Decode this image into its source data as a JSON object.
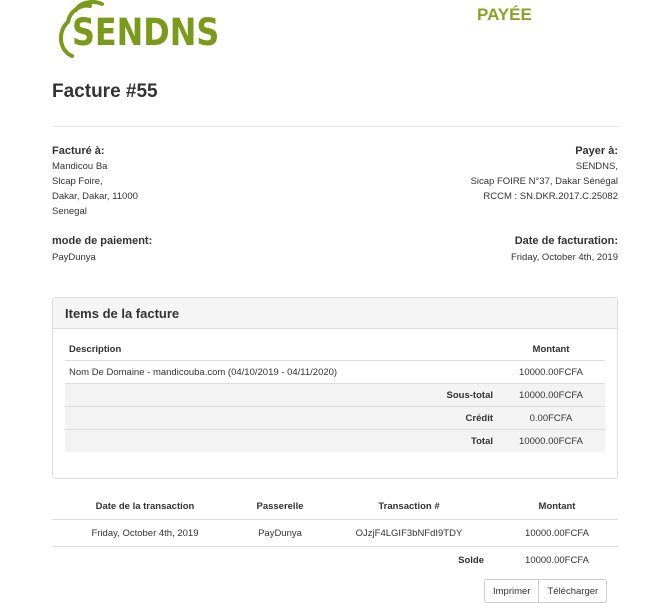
{
  "brand": {
    "logo_text": "SENDNS",
    "accent": "#7a9a1a"
  },
  "status": "PAYÉE",
  "invoice": {
    "title": "Facture #55"
  },
  "billed_to": {
    "label": "Facturé à:",
    "lines": [
      "Mandicou Ba",
      "Slcap Foire,",
      "Dakar, Dakar, 11000",
      "Senegal"
    ]
  },
  "pay_to": {
    "label": "Payer à:",
    "lines": [
      "SENDNS,",
      "Sicap FOIRE N°37, Dakar Sénégal",
      "RCCM : SN.DKR.2017.C.25082"
    ]
  },
  "payment_method": {
    "label": "mode de paiement:",
    "value": "PayDunya"
  },
  "invoice_date": {
    "label": "Date de facturation:",
    "value": "Friday, October 4th, 2019"
  },
  "items_panel": {
    "title": "Items de la facture",
    "headers": {
      "description": "Description",
      "amount": "Montant"
    },
    "rows": [
      {
        "description": "Nom De Domaine - mandicouba.com (04/10/2019 - 04/11/2020)",
        "amount": "10000.00FCFA"
      }
    ],
    "subtotal": {
      "label": "Sous-total",
      "value": "10000.00FCFA"
    },
    "credit": {
      "label": "Crédit",
      "value": "0.00FCFA"
    },
    "total": {
      "label": "Total",
      "value": "10000.00FCFA"
    }
  },
  "transactions": {
    "headers": {
      "date": "Date de la transaction",
      "gateway": "Passerelle",
      "id": "Transaction #",
      "amount": "Montant"
    },
    "rows": [
      {
        "date": "Friday, October 4th, 2019",
        "gateway": "PayDunya",
        "id": "OJzjF4LGIF3bNFdI9TDY",
        "amount": "10000.00FCFA"
      }
    ],
    "balance": {
      "label": "Solde",
      "value": "10000.00FCFA"
    }
  },
  "actions": {
    "print": "Imprimer",
    "download": "Télécharger"
  }
}
